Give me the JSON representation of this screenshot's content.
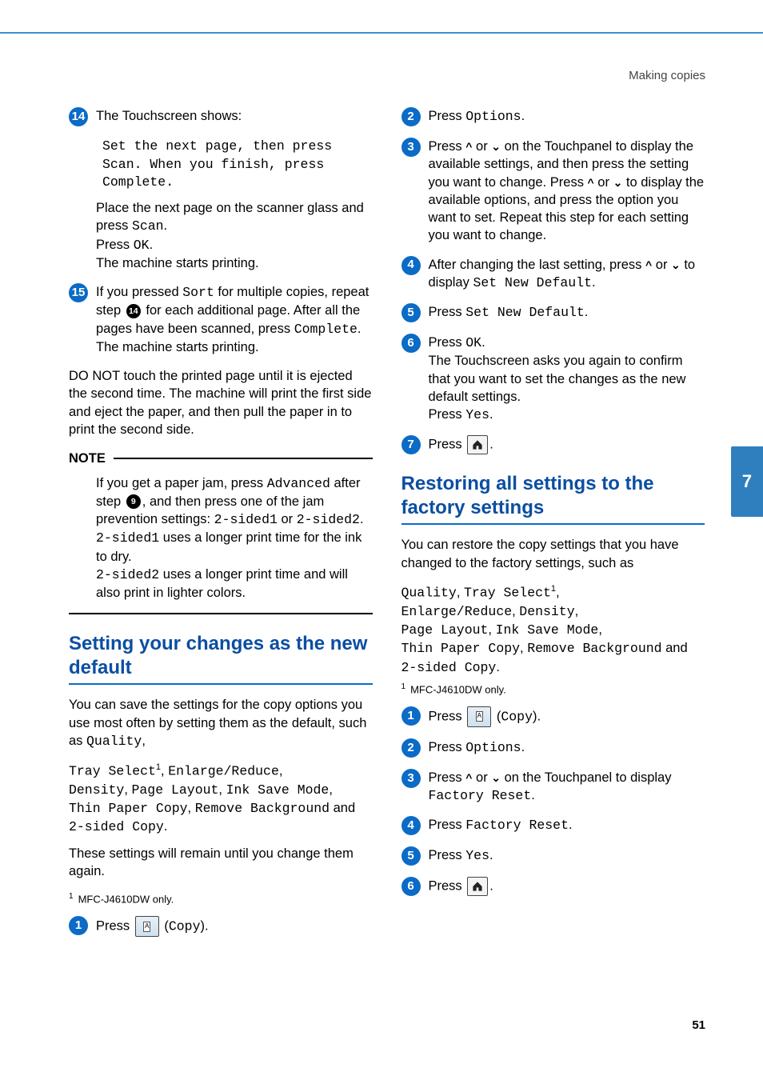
{
  "breadcrumb": "Making copies",
  "side_tab": "7",
  "page_number": "51",
  "left": {
    "step14": {
      "num": "14",
      "lead": "The Touchscreen shows:",
      "screen_msg": "Set the next page, then press Scan. When you finish, press Complete.",
      "p1a": "Place the next page on the scanner glass and press ",
      "p1b": "Scan",
      "p1c": ".",
      "p2a": "Press ",
      "p2b": "OK",
      "p2c": ".",
      "p3": "The machine starts printing."
    },
    "step15": {
      "num": "15",
      "l1a": "If you pressed ",
      "l1b": "Sort",
      "l1c": " for multiple copies, repeat step ",
      "l1ref": "14",
      "l1d": " for each additional page. After all the pages have been scanned, press ",
      "l1e": "Complete",
      "l1f": ".",
      "l2": "The machine starts printing."
    },
    "donot": "DO NOT touch the printed page until it is ejected the second time. The machine will print the first side and eject the paper, and then pull the paper in to print the second side.",
    "note_hd": "NOTE",
    "note": {
      "p1a": "If you get a paper jam, press ",
      "p1b": "Advanced",
      "p1c": " after step ",
      "p1ref": "9",
      "p1d": ", and then press one of the jam prevention settings: ",
      "p1e": "2-sided1",
      "p1f": " or ",
      "p1g": "2-sided2",
      "p1h": ".",
      "p2a": "2-sided1",
      "p2b": " uses a longer print time for the ink to dry.",
      "p3a": "2-sided2",
      "p3b": " uses a longer print time and will also print in lighter colors."
    },
    "h2": "Setting your changes as the new default",
    "intro_a": "You can save the settings for the copy options you use most often by setting them as the default, such as ",
    "intro_b": "Quality",
    "intro_c": ", ",
    "opts_line1a": "Tray Select",
    "opts_line1b": ", ",
    "opts_line1c": "Enlarge/Reduce",
    "opts_line1d": ", ",
    "opts_line2a": "Density",
    "opts_line2b": ", ",
    "opts_line2c": "Page Layout",
    "opts_line2d": ", ",
    "opts_line2e": "Ink Save Mode",
    "opts_line2f": ", ",
    "opts_line3a": "Thin Paper Copy",
    "opts_line3b": ", ",
    "opts_line3c": "Remove Background",
    "opts_line3d": " and ",
    "opts_line3e": "2-sided Copy",
    "opts_line3f": ".",
    "remain": "These settings will remain until you change them again.",
    "fn1": "MFC-J4610DW only.",
    "step1": {
      "num": "1",
      "a": "Press ",
      "b": " (",
      "c": "Copy",
      "d": ")."
    }
  },
  "right": {
    "step2": {
      "num": "2",
      "a": "Press ",
      "b": "Options",
      "c": "."
    },
    "step3": {
      "num": "3",
      "a": "Press ",
      "b": " or ",
      "c": " on the Touchpanel to display the available settings, and then press the setting you want to change. Press ",
      "d": " or ",
      "e": " to display the available options, and press the option you want to set. Repeat this step for each setting you want to change."
    },
    "step4": {
      "num": "4",
      "a": "After changing the last setting, press ",
      "b": " or ",
      "c": " to display ",
      "d": "Set New Default",
      "e": "."
    },
    "step5": {
      "num": "5",
      "a": "Press ",
      "b": "Set New Default",
      "c": "."
    },
    "step6": {
      "num": "6",
      "a": "Press ",
      "b": "OK",
      "c": ".",
      "d": "The Touchscreen asks you again to confirm that you want to set the changes as the new default settings.",
      "e": "Press ",
      "f": "Yes",
      "g": "."
    },
    "step7": {
      "num": "7",
      "a": "Press ",
      "b": "."
    },
    "h2": "Restoring all settings to the factory settings",
    "intro": "You can restore the copy settings that you have changed to the factory settings, such as",
    "l1a": "Quality",
    "l1b": ", ",
    "l1c": "Tray Select",
    "l1d": ", ",
    "l2a": "Enlarge/Reduce",
    "l2b": ", ",
    "l2c": "Density",
    "l2d": ", ",
    "l3a": "Page Layout",
    "l3b": ", ",
    "l3c": "Ink Save Mode",
    "l3d": ", ",
    "l4a": "Thin Paper Copy",
    "l4b": ", ",
    "l4c": "Remove Background",
    "l4d": " and ",
    "l4e": "2-sided Copy",
    "l4f": ".",
    "fn1": "MFC-J4610DW only.",
    "r_step1": {
      "num": "1",
      "a": "Press ",
      "b": " (",
      "c": "Copy",
      "d": ")."
    },
    "r_step2": {
      "num": "2",
      "a": "Press ",
      "b": "Options",
      "c": "."
    },
    "r_step3": {
      "num": "3",
      "a": "Press ",
      "b": " or ",
      "c": " on the Touchpanel to display ",
      "d": "Factory Reset",
      "e": "."
    },
    "r_step4": {
      "num": "4",
      "a": "Press ",
      "b": "Factory Reset",
      "c": "."
    },
    "r_step5": {
      "num": "5",
      "a": "Press ",
      "b": "Yes",
      "c": "."
    },
    "r_step6": {
      "num": "6",
      "a": "Press ",
      "b": "."
    }
  }
}
